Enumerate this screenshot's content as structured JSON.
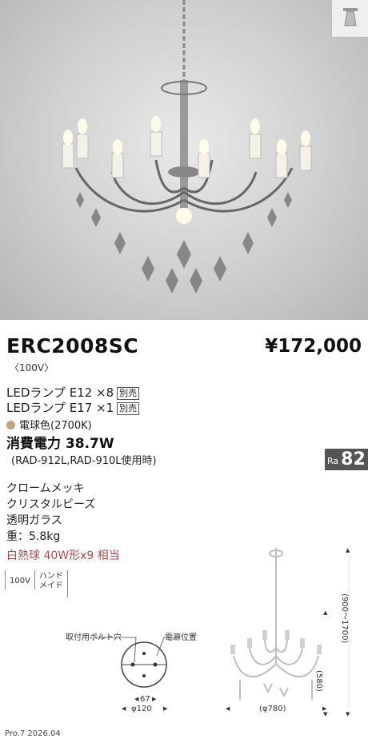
{
  "product": {
    "model": "ERC2008SC",
    "price": "¥172,000",
    "voltage": "〈100V〉"
  },
  "lamps": [
    {
      "text": "LEDランプ E12 ×8",
      "badge": "別売"
    },
    {
      "text": "LEDランプ E17 ×1",
      "badge": "別売"
    }
  ],
  "color_temp": "電球色(2700K)",
  "power": {
    "consumption": "消費電力 38.7W",
    "note": "(RAD-912L,RAD-910L使用時)"
  },
  "ra": {
    "label": "Ra",
    "value": "82"
  },
  "specs": [
    "クロームメッキ",
    "クリスタルビーズ",
    "透明ガラス",
    "重：5.8kg"
  ],
  "equivalent": "白熱球 40W形x9 相当",
  "feature_icons": {
    "voltage": "100V",
    "made": "ハンド\nメイド"
  },
  "diagram": {
    "bolt_label": "取付用ボルト穴",
    "power_label": "電源位置",
    "dim_67": "67",
    "dim_120": "φ120",
    "dim_780": "(φ780)",
    "dim_580": "(580)",
    "dim_height": "(900〜1700)"
  },
  "footer": "Pro.7 2026.04"
}
